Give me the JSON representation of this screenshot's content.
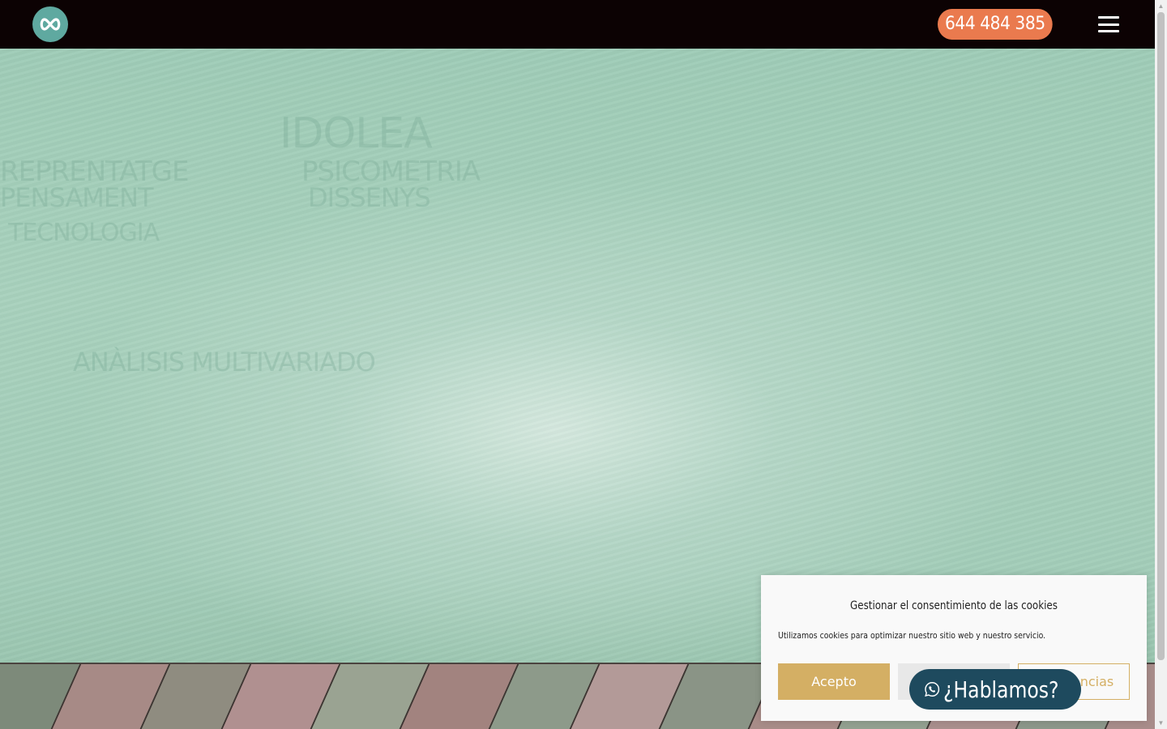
{
  "header": {
    "logo_icon": "infinity-logo-icon",
    "phone_label": "644 484 385",
    "menu_icon": "hamburger-menu-icon",
    "colors": {
      "bar": "#0c0203",
      "phone_button": "#ea7a4e",
      "logo": "#5fa9a0"
    }
  },
  "hero": {
    "background_words": [
      "IDOLEA",
      "REPRENTATGE",
      "PENSAMENT",
      "PSICOMETRIA",
      "DISSENYS",
      "TECNOLOGIA",
      "ANÀLISIS MULTIVARIADO"
    ]
  },
  "cookie_banner": {
    "title": "Gestionar el consentimiento de las cookies",
    "text": "Utilizamos cookies para optimizar nuestro sitio web y nuestro servicio.",
    "accept_label": "Acepto",
    "deny_label": "Denegar",
    "preferences_label": "Preferencias",
    "colors": {
      "accent": "#d4af64"
    }
  },
  "whatsapp": {
    "icon": "whatsapp-icon",
    "label": "¿Hablamos?",
    "color": "#1e4a5e"
  }
}
